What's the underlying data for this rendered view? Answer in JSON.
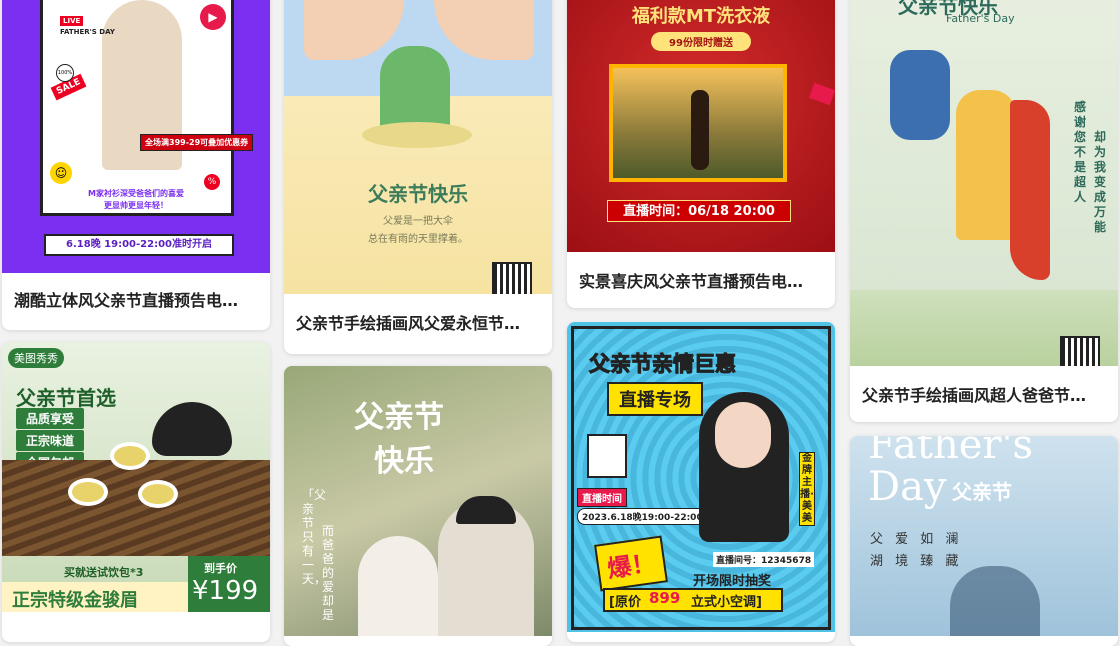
{
  "cards": [
    {
      "caption": "潮酷立体风父亲节直播预告电…",
      "texts": {
        "live": "LIVE",
        "fathers_day": "FATHER'S DAY",
        "sale": "SALE",
        "percent": "%",
        "badge100": "100%",
        "discount": "全场满399-29可叠加优惠券",
        "slogan1": "M家衬衫深受爸爸们的喜爱",
        "slogan2": "更显帅更显年轻！",
        "date": "6.18晚 19:00-22:00准时开启"
      }
    },
    {
      "caption": "父亲节首选",
      "texts": {
        "brand": "美图秀秀",
        "title": "父亲节首选",
        "item1": "品质享受",
        "item2": "正宗味道",
        "item3": "全国包邮",
        "gift": "买就送试饮包*3",
        "product": "正宗特级金骏眉",
        "price_label": "到手价",
        "price": "¥199",
        "caption_partial": "…"
      }
    },
    {
      "caption": "父亲节手绘插画风父爱永恒节…",
      "texts": {
        "title": "父亲节快乐",
        "line1": "父爱是一把大伞",
        "line2": "总在有雨的天里撑着。"
      }
    },
    {
      "caption": "",
      "texts": {
        "title1": "父亲节",
        "title2": "快乐",
        "poem1": "「父亲节只有一天，",
        "poem2": "而爸爸的爱却是"
      }
    },
    {
      "caption": "实景喜庆风父亲节直播预告电…",
      "texts": {
        "title": "福利款MT洗衣液",
        "sub": "99份限时赠送",
        "live_time": "直播时间：06/18 20:00"
      }
    },
    {
      "caption": "",
      "texts": {
        "title": "父亲节亲情巨惠",
        "sub": "直播专场",
        "live_label": "直播时间",
        "live_date": "2023.6.18晚19:00-22:00",
        "host": "金牌主播·美美",
        "room": "直播间号：12345678",
        "boom": "爆！",
        "lottery": "开场限时抽奖",
        "price_orig": "[原价",
        "price_num": "899",
        "price_item": "立式小空调]"
      }
    },
    {
      "caption": "父亲节手绘插画风超人爸爸节…",
      "texts": {
        "title": "父亲节快乐",
        "en": "Father's Day",
        "vert1": "感谢您不是超人",
        "vert2": "却为我变成万能"
      }
    },
    {
      "caption": "",
      "texts": {
        "en1": "Father's",
        "en2": "Day",
        "cn": "父亲节",
        "row1": "父 爱 如 澜",
        "row2": "湖 境 臻 藏"
      }
    }
  ]
}
